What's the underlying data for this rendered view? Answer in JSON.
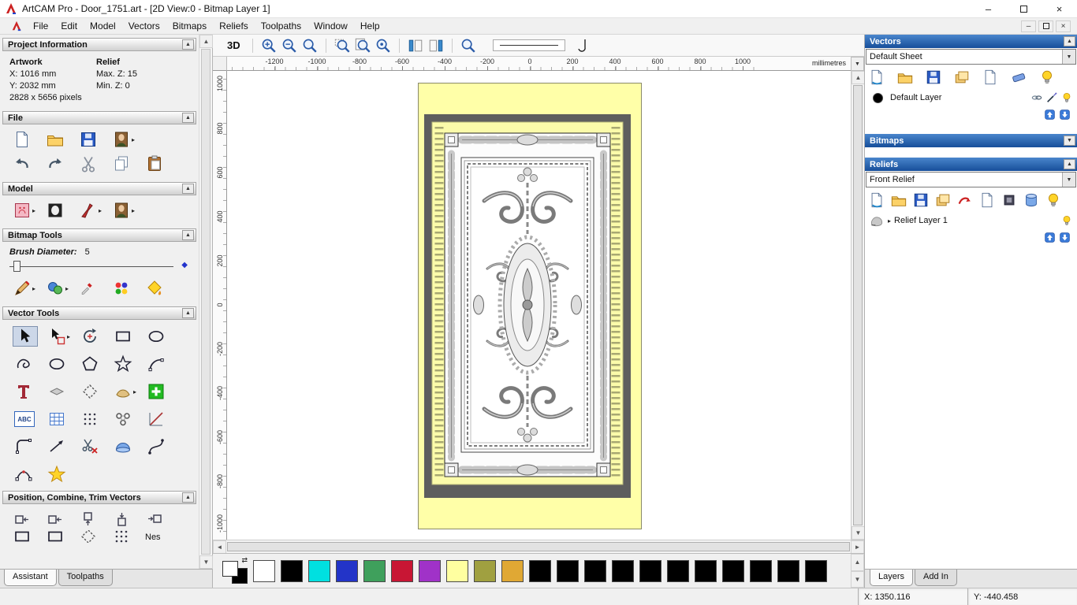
{
  "titlebar": {
    "title": "ArtCAM Pro - Door_1751.art - [2D View:0 - Bitmap Layer 1]"
  },
  "menubar": {
    "items": [
      "File",
      "Edit",
      "Model",
      "Vectors",
      "Bitmaps",
      "Reliefs",
      "Toolpaths",
      "Window",
      "Help"
    ]
  },
  "assistant": {
    "tabs": [
      "Assistant",
      "Toolpaths"
    ],
    "project_information": {
      "title": "Project Information",
      "artwork_header": "Artwork",
      "relief_header": "Relief",
      "artwork_x": "X: 1016 mm",
      "artwork_y": "Y: 2032 mm",
      "relief_max_z": "Max. Z: 15",
      "relief_min_z": "Min. Z: 0",
      "pixels": "2828 x 5656 pixels"
    },
    "file_section_title": "File",
    "model_section_title": "Model",
    "bitmap_tools_title": "Bitmap Tools",
    "brush_diameter_label": "Brush Diameter:",
    "brush_diameter_value": "5",
    "vector_tools_title": "Vector Tools",
    "position_section_title": "Position, Combine, Trim Vectors",
    "clipped_tool_label": "Nes",
    "icon_labels": {
      "abc": "ABC"
    }
  },
  "canvas": {
    "view3d_label": "3D",
    "units_label": "millimetres",
    "h_ticks": [
      "-1200",
      "-1000",
      "-800",
      "-600",
      "-400",
      "-200",
      "0",
      "200",
      "400",
      "600",
      "800",
      "1000"
    ],
    "v_ticks": [
      "1000",
      "800",
      "600",
      "400",
      "200",
      "0",
      "-200",
      "-400",
      "-600",
      "-800",
      "-1000"
    ]
  },
  "layers_panel": {
    "tabs": [
      "Layers",
      "Add In"
    ],
    "vectors": {
      "title": "Vectors",
      "sheet_selected": "Default Sheet",
      "layer_name": "Default Layer"
    },
    "bitmaps": {
      "title": "Bitmaps"
    },
    "reliefs": {
      "title": "Reliefs",
      "relief_selected": "Front Relief",
      "layer_name": "Relief Layer 1"
    }
  },
  "palette": {
    "colors": [
      "#ffffff",
      "#000000",
      "#00e0e0",
      "#2334c8",
      "#3fa05c",
      "#c81634",
      "#a032c8",
      "#ffffa0",
      "#a0a040",
      "#e0a834",
      "#000000",
      "#000000",
      "#000000",
      "#000000",
      "#000000",
      "#000000",
      "#000000",
      "#000000",
      "#000000",
      "#000000",
      "#000000"
    ]
  },
  "statusbar": {
    "x_coord": "X: 1350.116",
    "y_coord": "Y: -440.458"
  }
}
